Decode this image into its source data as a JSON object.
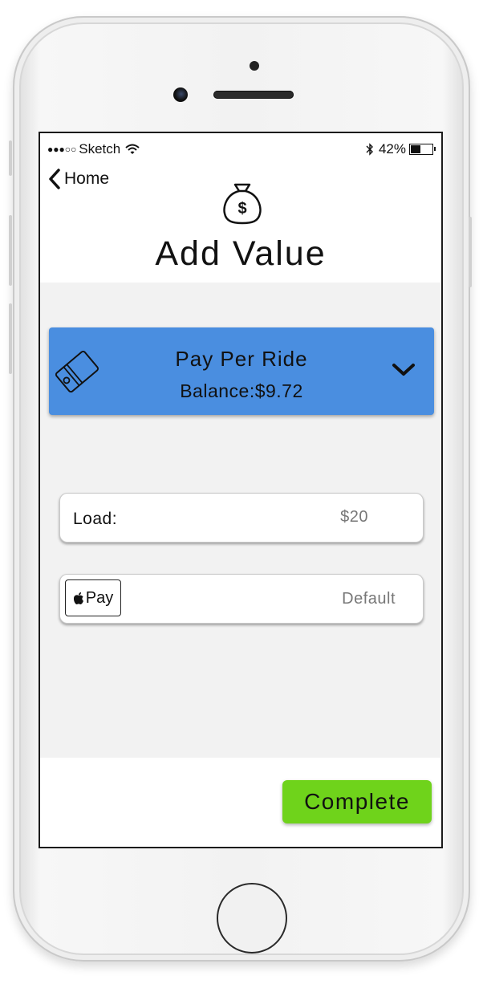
{
  "status_bar": {
    "signal_dots": "●●●○○",
    "carrier": "Sketch",
    "battery_percent": "42%"
  },
  "nav": {
    "back_label": "Home",
    "title": "Add Value"
  },
  "card": {
    "name": "Pay Per Ride",
    "balance": "Balance:$9.72"
  },
  "load": {
    "label": "Load:",
    "value": "$20"
  },
  "payment": {
    "method_label": "Pay",
    "value": "Default"
  },
  "actions": {
    "complete_label": "Complete",
    "complete_color": "#6fd31b"
  },
  "colors": {
    "card_bg": "#4a8ee0",
    "content_bg": "#f2f2f2"
  }
}
